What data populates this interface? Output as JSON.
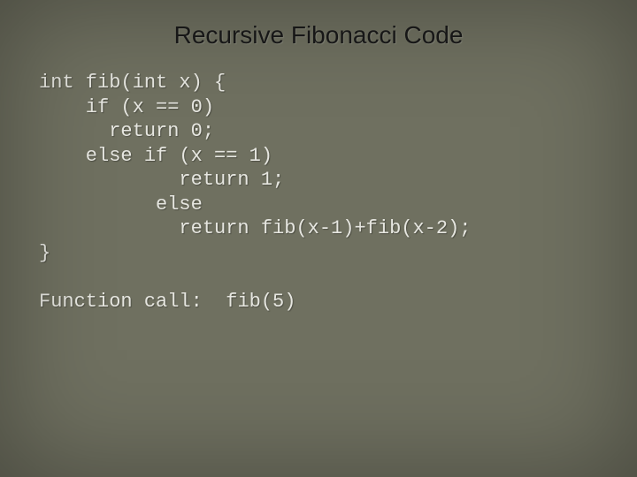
{
  "title": "Recursive Fibonacci Code",
  "code": {
    "l1": "int fib(int x) {",
    "l2": "    if (x == 0)",
    "l3": "      return 0;",
    "l4": "    else if (x == 1)",
    "l5": "            return 1;",
    "l6": "          else",
    "l7": "            return fib(x-1)+fib(x-2);",
    "l8": "}"
  },
  "call": {
    "label": "Function call:",
    "value": "fib(5)"
  }
}
